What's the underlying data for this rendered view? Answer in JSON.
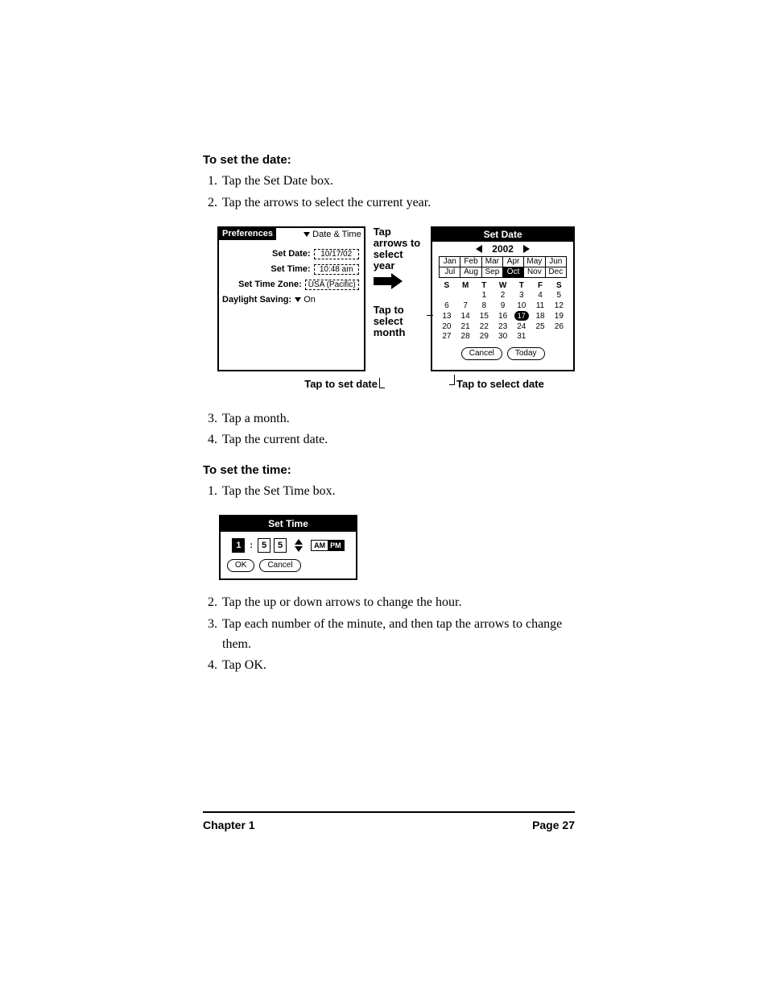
{
  "headings": {
    "set_date": "To set the date:",
    "set_time": "To set the time:"
  },
  "steps_date_a": [
    "Tap the Set Date box.",
    "Tap the arrows to select the current year."
  ],
  "steps_date_b": [
    "Tap a month.",
    "Tap the current date."
  ],
  "steps_time_a": [
    "Tap the Set Time box."
  ],
  "steps_time_b": [
    "Tap the up or down arrows to change the hour.",
    "Tap each number of the minute, and then tap the arrows to change them.",
    "Tap OK."
  ],
  "prefs": {
    "title": "Preferences",
    "menu": "Date & Time",
    "rows": {
      "set_date_lbl": "Set Date:",
      "set_date_val": "10/17/02",
      "set_time_lbl": "Set Time:",
      "set_time_val": "10:48 am",
      "set_tz_lbl": "Set Time Zone:",
      "set_tz_val": "USA (Pacific)",
      "dl_lbl": "Daylight Saving:",
      "dl_val": "On"
    }
  },
  "ann": {
    "tap_arrows": "Tap arrows to select year",
    "tap_month": "Tap to select month",
    "tap_set_date": "Tap to set date",
    "tap_select_date": "Tap to select date"
  },
  "setdate": {
    "title": "Set Date",
    "year": "2002",
    "months_r1": [
      "Jan",
      "Feb",
      "Mar",
      "Apr",
      "May",
      "Jun"
    ],
    "months_r2": [
      "Jul",
      "Aug",
      "Sep",
      "Oct",
      "Nov",
      "Dec"
    ],
    "selected_month_index": 9,
    "dow": [
      "S",
      "M",
      "T",
      "W",
      "T",
      "F",
      "S"
    ],
    "weeks": [
      [
        "",
        "",
        "1",
        "2",
        "3",
        "4",
        "5"
      ],
      [
        "6",
        "7",
        "8",
        "9",
        "10",
        "11",
        "12"
      ],
      [
        "13",
        "14",
        "15",
        "16",
        "17",
        "18",
        "19"
      ],
      [
        "20",
        "21",
        "22",
        "23",
        "24",
        "25",
        "26"
      ],
      [
        "27",
        "28",
        "29",
        "30",
        "31",
        "",
        ""
      ]
    ],
    "selected_day": "17",
    "cancel": "Cancel",
    "today": "Today"
  },
  "settime": {
    "title": "Set Time",
    "hour": "1",
    "min1": "5",
    "min2": "5",
    "am": "AM",
    "pm": "PM",
    "ok": "OK",
    "cancel": "Cancel"
  },
  "footer": {
    "chapter": "Chapter 1",
    "page": "Page 27"
  }
}
